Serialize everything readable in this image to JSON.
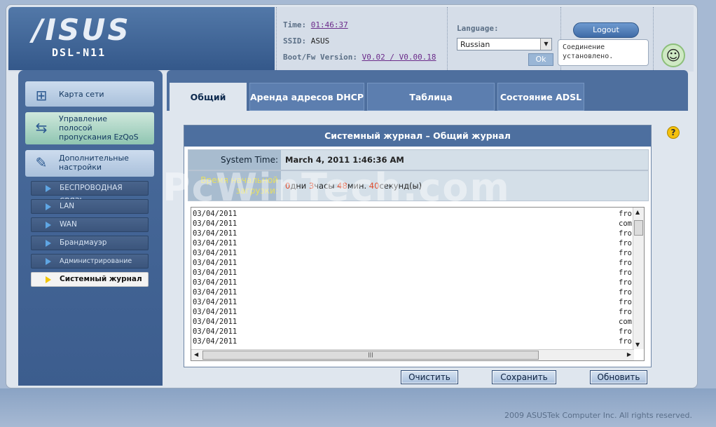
{
  "brand": {
    "logo": "/ISUS",
    "model": "DSL-N11"
  },
  "header": {
    "time_label": "Time:",
    "time_value": "01:46:37",
    "ssid_label": "SSID:",
    "ssid_value": "ASUS",
    "fw_label": "Boot/Fw Version:",
    "fw_value": "V0.02 / V0.00.18",
    "language_label": "Language:",
    "language_value": "Russian",
    "ok_label": "Ok",
    "logout_label": "Logout",
    "status_tooltip": "Соединение установлено."
  },
  "sidebar": {
    "items": [
      {
        "label": "Карта сети",
        "icon": "network-map-icon"
      },
      {
        "label": "Управление полосой пропускания EzQoS",
        "icon": "bandwidth-icon"
      },
      {
        "label": "Дополнительные настройки",
        "icon": "tools-icon"
      }
    ],
    "subitems": [
      {
        "label": "БЕСПРОВОДНАЯ СВЯЗЬ"
      },
      {
        "label": "LAN"
      },
      {
        "label": "WAN"
      },
      {
        "label": "Брандмауэр"
      },
      {
        "label": "Администрирование"
      },
      {
        "label": "Системный журнал",
        "active": true
      }
    ]
  },
  "tabs": [
    {
      "label": "Общий журнал",
      "active": true
    },
    {
      "label": "Аренда адресов DHCP"
    },
    {
      "label": "Таблица маршрутизации"
    },
    {
      "label": "Состояние ADSL"
    }
  ],
  "log_panel": {
    "title": "Системный журнал – Общий журнал",
    "system_time_label": "System Time:",
    "system_time_value": "March 4, 2011 1:46:36 AM",
    "uptime_label": "Время начальной загрузки:",
    "uptime": {
      "days": "0",
      "days_unit": "дни ",
      "hours": "3",
      "hours_unit": "часы ",
      "minutes": "48",
      "minutes_unit": "мин. ",
      "seconds": "40",
      "seconds_unit": "секунд(ы)"
    },
    "lines": [
      "03/04/2011",
      "03/04/2011",
      "03/04/2011",
      "03/04/2011",
      "03/04/2011",
      "03/04/2011",
      "03/04/2011",
      "03/04/2011",
      "03/04/2011",
      "03/04/2011",
      "03/04/2011",
      "03/04/2011",
      "03/04/2011",
      "03/04/2011"
    ],
    "lines_right": [
      "fro",
      "com",
      "fro",
      "fro",
      "fro",
      "fro",
      "fro",
      "fro",
      "fro",
      "fro",
      "fro",
      "com",
      "fro",
      "fro"
    ]
  },
  "buttons": {
    "clear": "Очистить",
    "save": "Сохранить",
    "refresh": "Обновить"
  },
  "footer": {
    "copyright": "2009 ASUSTek Computer Inc. All rights reserved."
  },
  "watermark": "PcWinTech.com"
}
